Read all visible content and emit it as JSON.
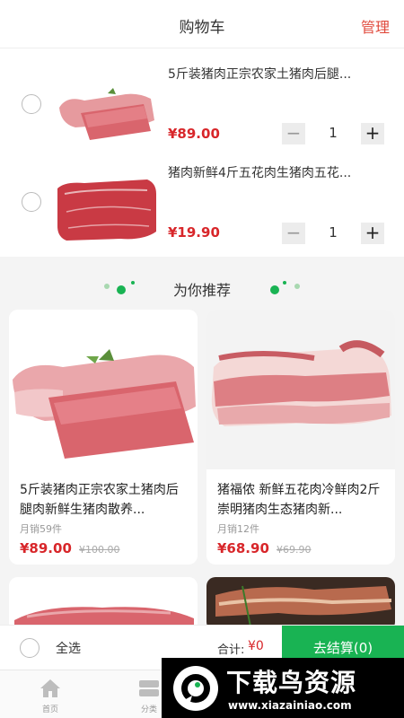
{
  "header": {
    "title": "购物车",
    "manage_label": "管理"
  },
  "cart": {
    "items": [
      {
        "name": "5斤装猪肉正宗农家土猪肉后腿...",
        "price": "¥89.00",
        "quantity": "1",
        "minus": "−",
        "plus": "+"
      },
      {
        "name": "猪肉新鲜4斤五花肉生猪肉五花...",
        "price": "¥19.90",
        "quantity": "1",
        "minus": "−",
        "plus": "+"
      }
    ]
  },
  "recommend": {
    "title": "为你推荐",
    "products": [
      {
        "name": "5斤装猪肉正宗农家土猪肉后腿肉新鲜生猪肉散养...",
        "sales": "月销59件",
        "price": "¥89.00",
        "original_price": "¥100.00"
      },
      {
        "name": "猪福侬 新鲜五花肉冷鲜肉2斤崇明猪肉生态猪肉新...",
        "sales": "月销12件",
        "price": "¥68.90",
        "original_price": "¥69.90"
      }
    ]
  },
  "bottom_bar": {
    "select_all_label": "全选",
    "total_label": "合计:",
    "total_value": "¥0",
    "checkout_label": "去结算(0)"
  },
  "tabbar": {
    "tabs": [
      {
        "label": "首页",
        "icon": "home-icon"
      },
      {
        "label": "分类",
        "icon": "category-icon"
      }
    ]
  },
  "watermark": {
    "title": "下载鸟资源",
    "url": "www.xiazainiao.com"
  },
  "colors": {
    "accent_red": "#d8262a",
    "manage_red": "#e04a3c",
    "checkout_green": "#19b353"
  }
}
